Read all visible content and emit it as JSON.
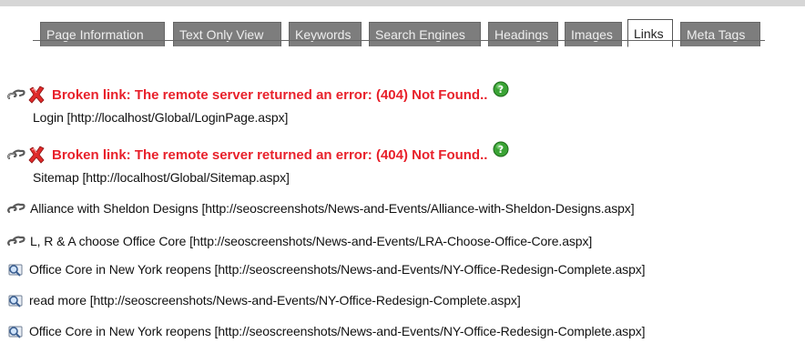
{
  "tabs": [
    {
      "label": "Page Information",
      "active": false
    },
    {
      "label": "Text Only View",
      "active": false
    },
    {
      "label": "Keywords",
      "active": false
    },
    {
      "label": "Search Engines",
      "active": false
    },
    {
      "label": "Headings",
      "active": false
    },
    {
      "label": "Images",
      "active": false
    },
    {
      "label": "Links",
      "active": true
    },
    {
      "label": "Meta Tags",
      "active": false
    }
  ],
  "links": [
    {
      "broken": true,
      "error_message": "Broken link: The remote server returned an error: (404) Not Found..",
      "text": "Login [http://localhost/Global/LoginPage.aspx]",
      "icons": [
        "chain-link-icon",
        "red-x-icon",
        "green-help-icon"
      ]
    },
    {
      "broken": true,
      "error_message": "Broken link: The remote server returned an error: (404) Not Found..",
      "text": "Sitemap [http://localhost/Global/Sitemap.aspx]",
      "icons": [
        "chain-link-icon",
        "red-x-icon",
        "green-help-icon"
      ]
    },
    {
      "broken": false,
      "text": "Alliance with Sheldon Designs [http://seoscreenshots/News-and-Events/Alliance-with-Sheldon-Designs.aspx]",
      "icons": [
        "chain-link-icon"
      ]
    },
    {
      "broken": false,
      "text": "L, R & A choose Office Core [http://seoscreenshots/News-and-Events/LRA-Choose-Office-Core.aspx]",
      "icons": [
        "chain-link-icon"
      ]
    },
    {
      "broken": false,
      "text": "Office Core in New York reopens [http://seoscreenshots/News-and-Events/NY-Office-Redesign-Complete.aspx]",
      "icons": [
        "magnifier-icon"
      ]
    },
    {
      "broken": false,
      "text": "read more [http://seoscreenshots/News-and-Events/NY-Office-Redesign-Complete.aspx]",
      "icons": [
        "magnifier-icon"
      ]
    },
    {
      "broken": false,
      "text": "Office Core in New York reopens [http://seoscreenshots/News-and-Events/NY-Office-Redesign-Complete.aspx]",
      "icons": [
        "magnifier-icon"
      ]
    }
  ],
  "colors": {
    "error_red": "#e8212b",
    "tab_inactive": "#7d7d7d",
    "tab_active": "#ffffff",
    "help_green": "#3aa335"
  }
}
